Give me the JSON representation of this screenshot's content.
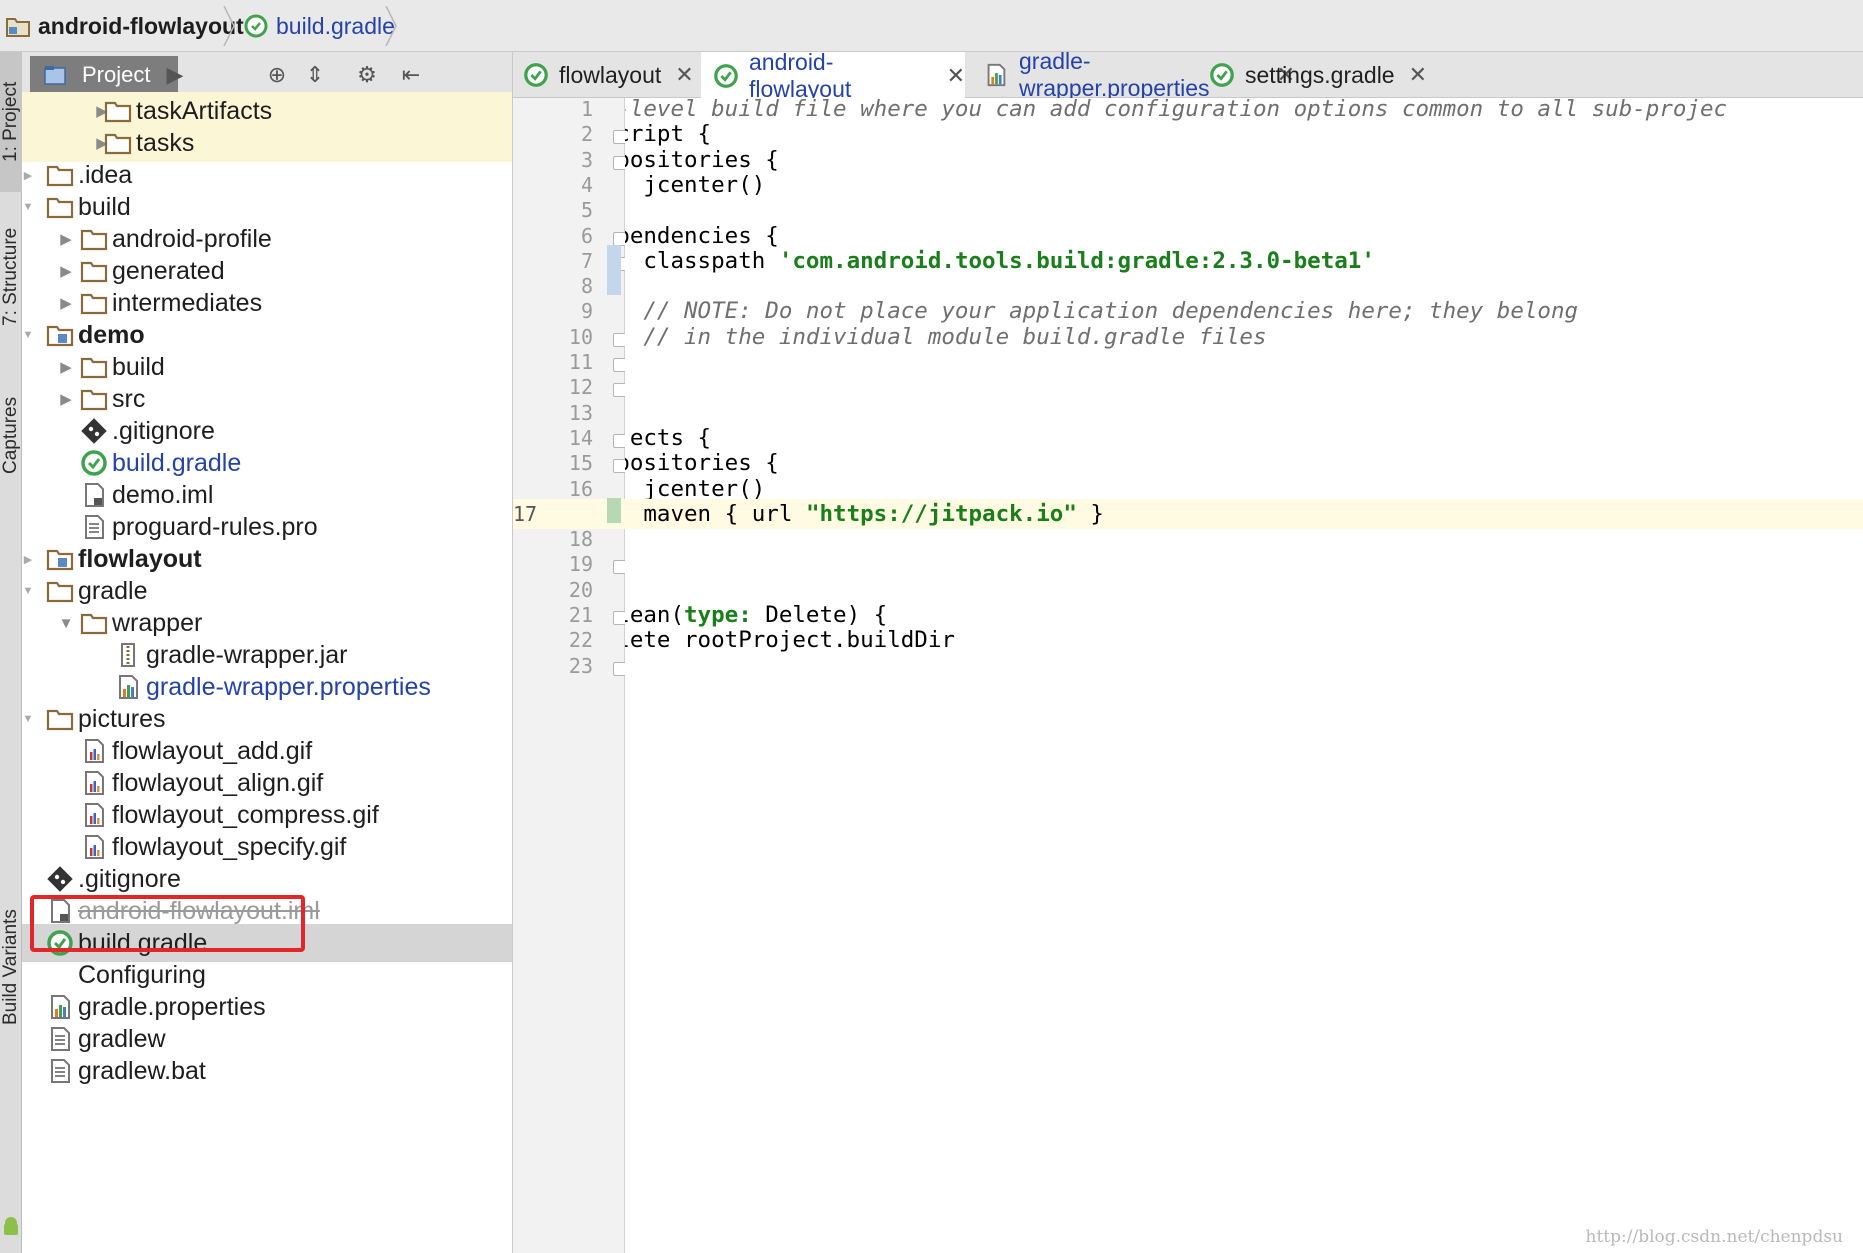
{
  "breadcrumb": {
    "project": "android-flowlayout",
    "file": "build.gradle"
  },
  "left_strip": {
    "project_tab": "1: Project",
    "structure_tab": "7: Structure",
    "captures_tab": "Captures",
    "build_variants_tab": "Build Variants"
  },
  "project_panel": {
    "tab_label": "Project"
  },
  "tree": [
    {
      "label": "taskArtifacts",
      "icon": "folder-icon",
      "arrow": "right"
    },
    {
      "label": "tasks",
      "icon": "folder-icon",
      "arrow": "right"
    },
    {
      "label": ".idea",
      "icon": "folder-icon",
      "arrow": "right-small"
    },
    {
      "label": "build",
      "icon": "folder-icon",
      "arrow": "down-small"
    },
    {
      "label": "android-profile",
      "icon": "folder-icon",
      "arrow": "right"
    },
    {
      "label": "generated",
      "icon": "folder-icon",
      "arrow": "right"
    },
    {
      "label": "intermediates",
      "icon": "folder-icon",
      "arrow": "right"
    },
    {
      "label": "demo",
      "icon": "module-icon",
      "arrow": "down-small"
    },
    {
      "label": "build",
      "icon": "folder-icon",
      "arrow": "right"
    },
    {
      "label": "src",
      "icon": "folder-icon",
      "arrow": "right"
    },
    {
      "label": ".gitignore",
      "icon": "git-icon"
    },
    {
      "label": "build.gradle",
      "icon": "gradle-icon"
    },
    {
      "label": "demo.iml",
      "icon": "iml-icon"
    },
    {
      "label": "proguard-rules.pro",
      "icon": "text-file-icon"
    },
    {
      "label": "flowlayout",
      "icon": "module-icon",
      "arrow": "right-small"
    },
    {
      "label": "gradle",
      "icon": "folder-icon",
      "arrow": "down-small"
    },
    {
      "label": "wrapper",
      "icon": "folder-icon",
      "arrow": "down"
    },
    {
      "label": "gradle-wrapper.jar",
      "icon": "jar-icon"
    },
    {
      "label": "gradle-wrapper.properties",
      "icon": "properties-icon"
    },
    {
      "label": "pictures",
      "icon": "folder-icon",
      "arrow": "down-small"
    },
    {
      "label": "flowlayout_add.gif",
      "icon": "image-file-icon"
    },
    {
      "label": "flowlayout_align.gif",
      "icon": "image-file-icon"
    },
    {
      "label": "flowlayout_compress.gif",
      "icon": "image-file-icon"
    },
    {
      "label": "flowlayout_specify.gif",
      "icon": "image-file-icon"
    },
    {
      "label": ".gitignore",
      "icon": "git-icon"
    },
    {
      "label": "android-flowlayout.iml",
      "icon": "iml-icon"
    },
    {
      "label": "build.gradle",
      "icon": "gradle-icon"
    },
    {
      "label": "Configuring",
      "icon": "blank-icon"
    },
    {
      "label": "gradle.properties",
      "icon": "properties-icon"
    },
    {
      "label": "gradlew",
      "icon": "text-file-icon"
    },
    {
      "label": "gradlew.bat",
      "icon": "text-file-icon"
    }
  ],
  "editor_tabs": [
    {
      "label": "flowlayout",
      "icon": "gradle-icon",
      "close": "✕"
    },
    {
      "label": "android-flowlayout",
      "icon": "gradle-icon",
      "close": "✕"
    },
    {
      "label": "gradle-wrapper.properties",
      "icon": "properties-icon",
      "close": "✕"
    },
    {
      "label": "settings.gradle",
      "icon": "gradle-icon",
      "close": "✕"
    }
  ],
  "editor": {
    "line_numbers": [
      "1",
      "2",
      "3",
      "4",
      "5",
      "6",
      "7",
      "8",
      "9",
      "10",
      "11",
      "12",
      "13",
      "14",
      "15",
      "16",
      "17",
      "18",
      "19",
      "20",
      "21",
      "22",
      "23"
    ],
    "current_line": 17,
    "lines": [
      [
        {
          "t": "// Top-level build file where you can add configuration options common to all sub-projec",
          "c": "cmt"
        }
      ],
      [
        {
          "t": "buildscript {",
          "c": ""
        }
      ],
      [
        {
          "t": "    repositories {",
          "c": ""
        }
      ],
      [
        {
          "t": "        jcenter()",
          "c": ""
        }
      ],
      [
        {
          "t": "    }",
          "c": ""
        }
      ],
      [
        {
          "t": "    dependencies {",
          "c": ""
        }
      ],
      [
        {
          "t": "        classpath ",
          "c": ""
        },
        {
          "t": "'com.android.tools.build:gradle:2.3.0-beta1'",
          "c": "str"
        }
      ],
      [
        {
          "t": "",
          "c": ""
        }
      ],
      [
        {
          "t": "        // NOTE: Do not place your application dependencies here; they belong",
          "c": "cmt"
        }
      ],
      [
        {
          "t": "        // in the individual module build.gradle files",
          "c": "cmt"
        }
      ],
      [
        {
          "t": "    }",
          "c": ""
        }
      ],
      [
        {
          "t": "}",
          "c": ""
        }
      ],
      [
        {
          "t": "",
          "c": ""
        }
      ],
      [
        {
          "t": "allprojects {",
          "c": ""
        }
      ],
      [
        {
          "t": "    repositories {",
          "c": ""
        }
      ],
      [
        {
          "t": "        jcenter()",
          "c": ""
        }
      ],
      [
        {
          "t": "        maven { url ",
          "c": ""
        },
        {
          "t": "\"https://jitpack.io\"",
          "c": "str"
        },
        {
          "t": " }",
          "c": ""
        }
      ],
      [
        {
          "t": "    }",
          "c": ""
        }
      ],
      [
        {
          "t": "}",
          "c": ""
        }
      ],
      [
        {
          "t": "",
          "c": ""
        }
      ],
      [
        {
          "t": "task clean(",
          "c": ""
        },
        {
          "t": "type:",
          "c": "kw"
        },
        {
          "t": " Delete) {",
          "c": ""
        }
      ],
      [
        {
          "t": "    delete rootProject.buildDir",
          "c": ""
        }
      ],
      [
        {
          "t": "}",
          "c": ""
        }
      ]
    ]
  },
  "watermark": "http://blog.csdn.net/chenpdsu",
  "colors": {
    "accent_green": "#1a7f1a",
    "selection": "#d5d5d5",
    "highlight_box": "#e3262a",
    "link_blue": "#2442a8"
  }
}
